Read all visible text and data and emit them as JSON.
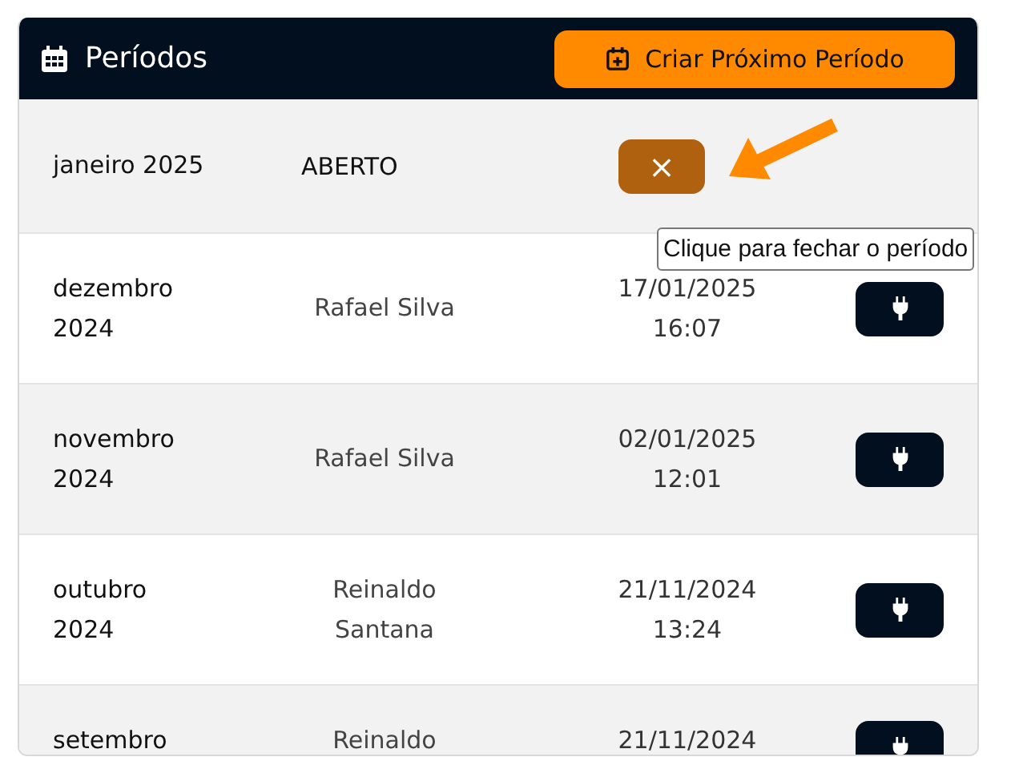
{
  "header": {
    "title": "Períodos",
    "create_button": "Criar Próximo Período"
  },
  "rows": [
    {
      "kind": "open",
      "month": "janeiro 2025",
      "status": "ABERTO",
      "close_button": "×"
    },
    {
      "kind": "closed",
      "month": "dezembro 2024",
      "user": "Rafael Silva",
      "date": "17/01/2025",
      "time": "16:07"
    },
    {
      "kind": "closed",
      "month": "novembro 2024",
      "user": "Rafael Silva",
      "date": "02/01/2025",
      "time": "12:01"
    },
    {
      "kind": "closed",
      "month": "outubro 2024",
      "user": "Reinaldo Santana",
      "date": "21/11/2024",
      "time": "13:24"
    },
    {
      "kind": "closed",
      "month": "setembro",
      "user": "Reinaldo",
      "date": "21/11/2024"
    }
  ],
  "tooltip": "Clique para fechar o período"
}
